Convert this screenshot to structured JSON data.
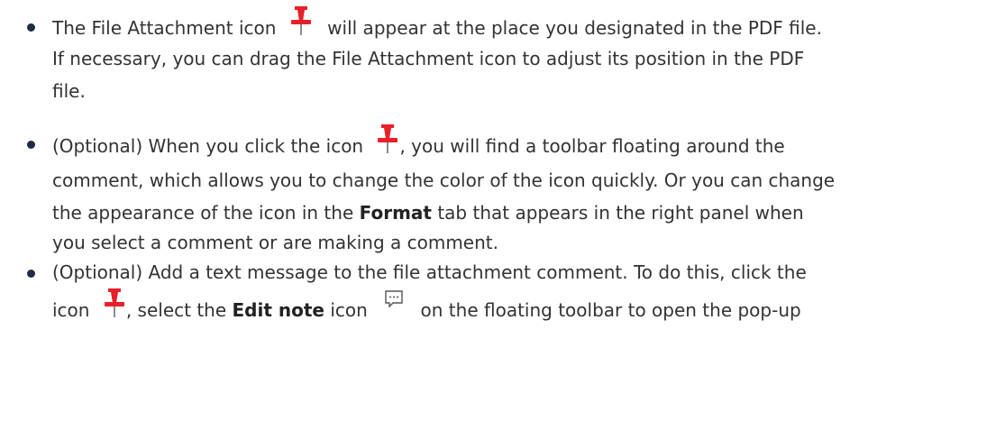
{
  "bullets": [
    {
      "lines": [
        {
          "before": "The File Attachment icon",
          "after": "will appear at the place you designated in the PDF file."
        },
        {
          "text": "If necessary, you can drag the File Attachment icon to adjust its position in the PDF"
        },
        {
          "text": "file."
        }
      ]
    },
    {
      "lines": [
        {
          "before": "(Optional) When you click the icon",
          "after": ", you will find a toolbar floating around the"
        },
        {
          "text": "comment, which allows you to change the color of the icon quickly. Or you can change"
        },
        {
          "before": "the appearance of the icon in the",
          "bold": "Format",
          "after": "tab that appears in the right panel when"
        },
        {
          "text": "you select a comment or are making a comment."
        }
      ]
    },
    {
      "lines": [
        {
          "text": "(Optional) Add a text message to the file attachment comment. To do this, click the"
        },
        {
          "before": "icon",
          "mid1": ", select the",
          "bold": "Edit note",
          "mid2": "icon",
          "after": "on the floating toolbar to open the pop-up"
        }
      ]
    }
  ],
  "icons": {
    "pin": "pushpin-icon",
    "note": "speech-bubble-icon"
  },
  "colors": {
    "pin": "#e8202a",
    "text": "#333333",
    "bullet": "#1f2a44"
  }
}
